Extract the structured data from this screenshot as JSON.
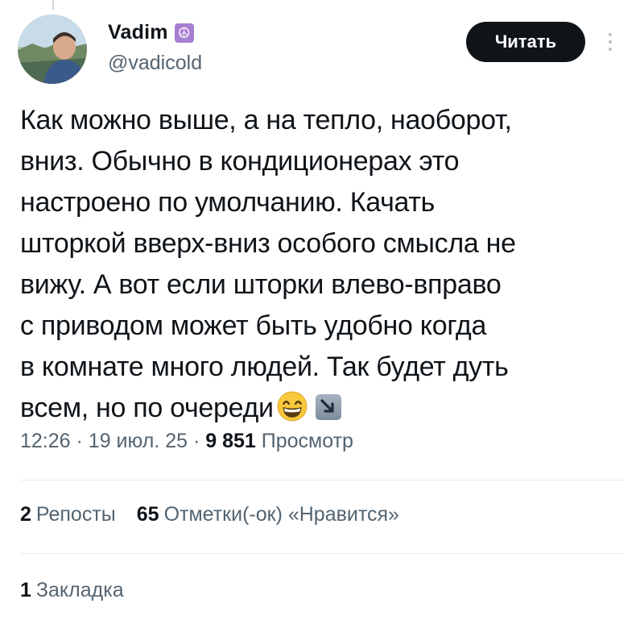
{
  "author": {
    "name": "Vadim",
    "badge_icon": "peace-symbol-icon",
    "badge_color": "#a77fd1",
    "handle": "@vadicold"
  },
  "follow_button_label": "Читать",
  "tweet_lines": [
    "Как можно выше, а на тепло, наоборот,",
    "вниз. Обычно в кондиционерах это",
    "настроено по умолчанию. Качать",
    "шторкой вверх-вниз особого смысла не",
    "вижу. А вот если шторки влево-вправо",
    "с приводом может быть удобно когда",
    "в комнате много людей. Так будет дуть",
    "всем, но по очереди"
  ],
  "tweet_emojis": [
    "grinning-face-icon",
    "down-right-arrow-icon"
  ],
  "meta": {
    "time": "12:26",
    "separator": "·",
    "date": "19 июл. 25",
    "views_count": "9 851",
    "views_label": "Просмотр"
  },
  "stats": {
    "reposts_count": "2",
    "reposts_label": "Репосты",
    "likes_count": "65",
    "likes_label": "Отметки(-ок) «Нравится»",
    "bookmarks_count": "1",
    "bookmarks_label": "Закладка"
  },
  "colors": {
    "text_primary": "#0f1419",
    "text_secondary": "#536471",
    "divider": "#e7eaed",
    "button_bg": "#0f1419"
  }
}
